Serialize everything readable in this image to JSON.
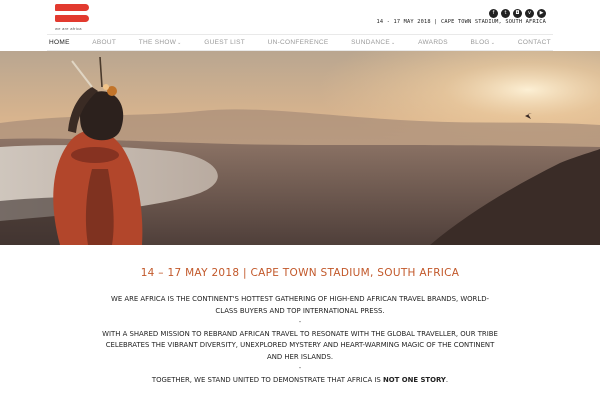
{
  "header": {
    "logo_text": "we are africa",
    "event_line": "14 - 17 MAY 2018 | CAPE TOWN STADIUM, SOUTH AFRICA",
    "socials": [
      {
        "name": "facebook-icon",
        "glyph": "f"
      },
      {
        "name": "twitter-icon",
        "glyph": "t"
      },
      {
        "name": "instagram-icon",
        "glyph": "◘"
      },
      {
        "name": "vimeo-icon",
        "glyph": "v"
      },
      {
        "name": "youtube-icon",
        "glyph": "▶"
      }
    ]
  },
  "nav": {
    "items": [
      {
        "label": "HOME",
        "active": true
      },
      {
        "label": "ABOUT"
      },
      {
        "label": "THE SHOW",
        "caret": "⌄"
      },
      {
        "label": "GUEST LIST"
      },
      {
        "label": "UN-CONFERENCE"
      },
      {
        "label": "SUNDANCE",
        "caret": "⌄"
      },
      {
        "label": "AWARDS"
      },
      {
        "label": "BLOG",
        "caret": "⌄"
      },
      {
        "label": "CONTACT"
      }
    ]
  },
  "main": {
    "dates_heading": "14 – 17 MAY 2018 | CAPE TOWN STADIUM, SOUTH AFRICA",
    "para1": "WE ARE AFRICA IS THE CONTINENT'S HOTTEST GATHERING OF HIGH-END AFRICAN TRAVEL BRANDS, WORLD-CLASS BUYERS AND TOP INTERNATIONAL PRESS.",
    "sep1": "-",
    "para2": "WITH A SHARED MISSION TO REBRAND AFRICAN TRAVEL TO RESONATE WITH THE GLOBAL TRAVELLER, OUR TRIBE CELEBRATES THE VIBRANT DIVERSITY, UNEXPLORED MYSTERY AND HEART-WARMING MAGIC OF THE CONTINENT AND HER ISLANDS.",
    "sep2": "-",
    "para3_prefix": "TOGETHER, WE STAND UNITED TO DEMONSTRATE THAT AFRICA IS ",
    "para3_bold": "NOT ONE STORY",
    "para3_suffix": "."
  },
  "colors": {
    "brand_red": "#e23a2f",
    "heading_orange": "#c2582a"
  }
}
